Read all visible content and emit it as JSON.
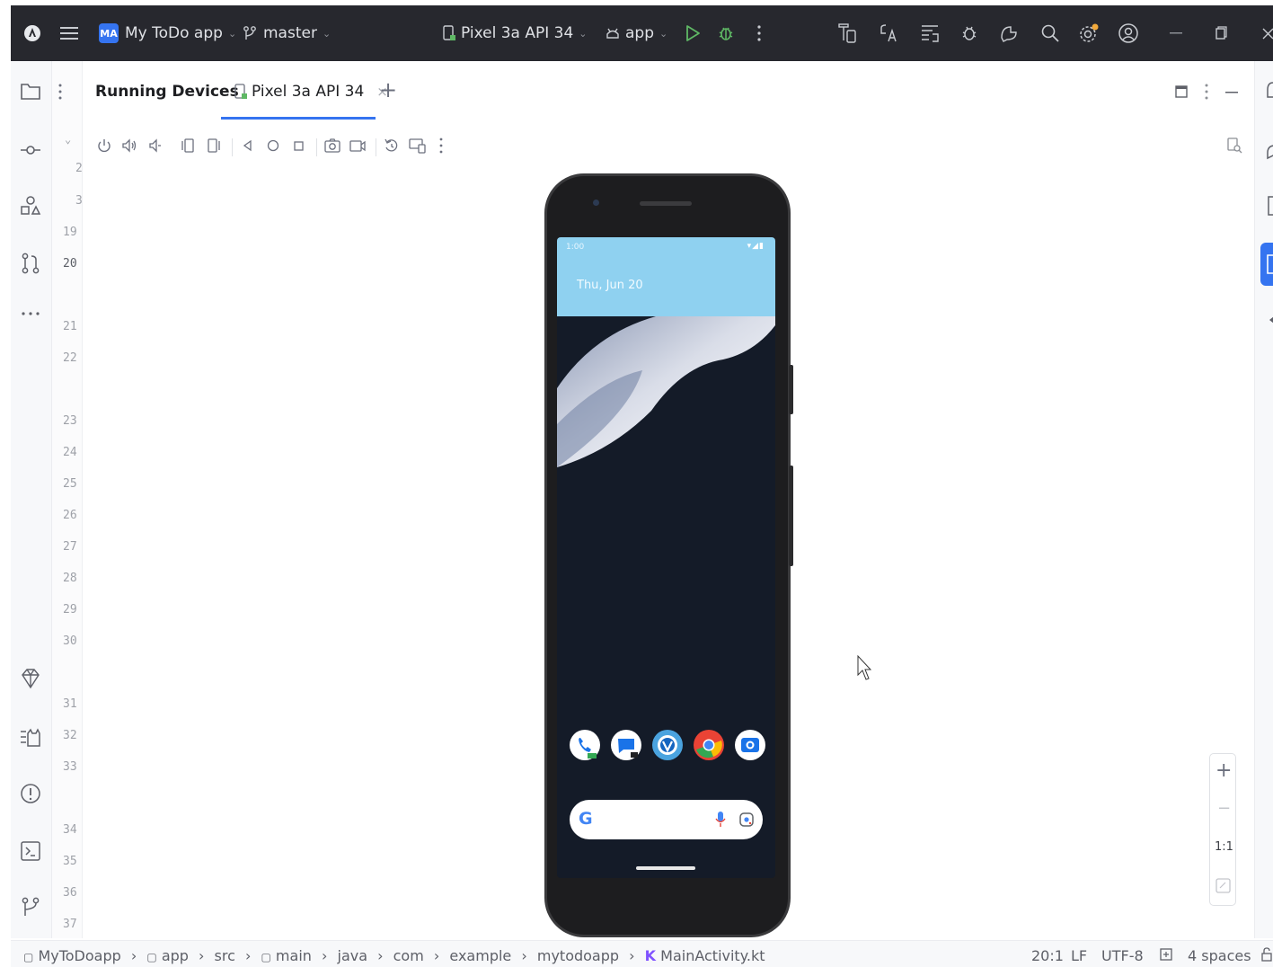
{
  "title_bar": {
    "project_initials": "MA",
    "project_name": "My ToDo app",
    "branch": "master",
    "device": "Pixel 3a API 34",
    "run_config": "app"
  },
  "tool_window": {
    "title": "Running Devices",
    "device_tab": "Pixel 3a API 34",
    "close_glyph": "×",
    "add_glyph": "+"
  },
  "gutter": {
    "line_numbers": [
      "2",
      "3",
      "19",
      "20",
      "21",
      "22",
      "23",
      "24",
      "25",
      "26",
      "27",
      "28",
      "29",
      "30",
      "31",
      "32",
      "33",
      "34",
      "35",
      "36",
      "37"
    ],
    "current_line": "20"
  },
  "device_screen": {
    "status_time": "1:00",
    "date": "Thu, Jun 20",
    "dock_apps": [
      "phone-app",
      "messages-app",
      "app-3",
      "chrome-app",
      "camera-app"
    ],
    "search_logo": "G"
  },
  "zoom": {
    "zoom_in": "+",
    "zoom_out": "−",
    "actual_size": "1:1"
  },
  "breadcrumb": [
    "MyToDoapp",
    "app",
    "src",
    "main",
    "java",
    "com",
    "example",
    "mytodoapp",
    "MainActivity.kt"
  ],
  "status": {
    "position": "20:1",
    "line_separator": "LF",
    "encoding": "UTF-8",
    "indent": "4 spaces"
  },
  "colors": {
    "title_bar_bg": "#27282e",
    "accent": "#3574f0",
    "shade": "#8fd1f0"
  }
}
